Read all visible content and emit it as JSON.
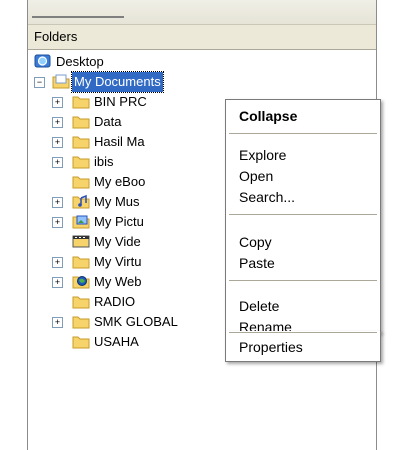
{
  "panel": {
    "title": "Folders"
  },
  "tree": {
    "desktop": "Desktop",
    "my_documents": "My Documents",
    "items": [
      {
        "label": "BIN PRC",
        "expander": "+",
        "icon": "folder-icon"
      },
      {
        "label": "Data",
        "expander": "+",
        "icon": "folder-icon"
      },
      {
        "label": "Hasil Ma",
        "expander": "+",
        "icon": "folder-icon"
      },
      {
        "label": "ibis",
        "expander": "+",
        "icon": "folder-icon"
      },
      {
        "label": "My eBoo",
        "expander": "",
        "icon": "folder-icon"
      },
      {
        "label": "My Mus",
        "expander": "+",
        "icon": "music-folder-icon"
      },
      {
        "label": "My Pictu",
        "expander": "+",
        "icon": "pictures-folder-icon"
      },
      {
        "label": "My Vide",
        "expander": "",
        "icon": "video-folder-icon"
      },
      {
        "label": "My Virtu",
        "expander": "+",
        "icon": "folder-icon"
      },
      {
        "label": "My Web",
        "expander": "+",
        "icon": "web-folder-icon"
      },
      {
        "label": "RADIO",
        "expander": "",
        "icon": "folder-icon"
      },
      {
        "label": "SMK GLOBAL",
        "expander": "+",
        "icon": "folder-icon"
      },
      {
        "label": "USAHA",
        "expander": "",
        "icon": "folder-icon"
      }
    ],
    "my_documents_expander": "−"
  },
  "context_menu": {
    "collapse": "Collapse",
    "explore": "Explore",
    "open": "Open",
    "search": "Search...",
    "copy": "Copy",
    "paste": "Paste",
    "delete": "Delete",
    "rename": "Rename",
    "properties": "Properties"
  },
  "colors": {
    "selection": "#316ac5",
    "folder": "#f6d46b",
    "expander_border": "#7f9db9"
  }
}
